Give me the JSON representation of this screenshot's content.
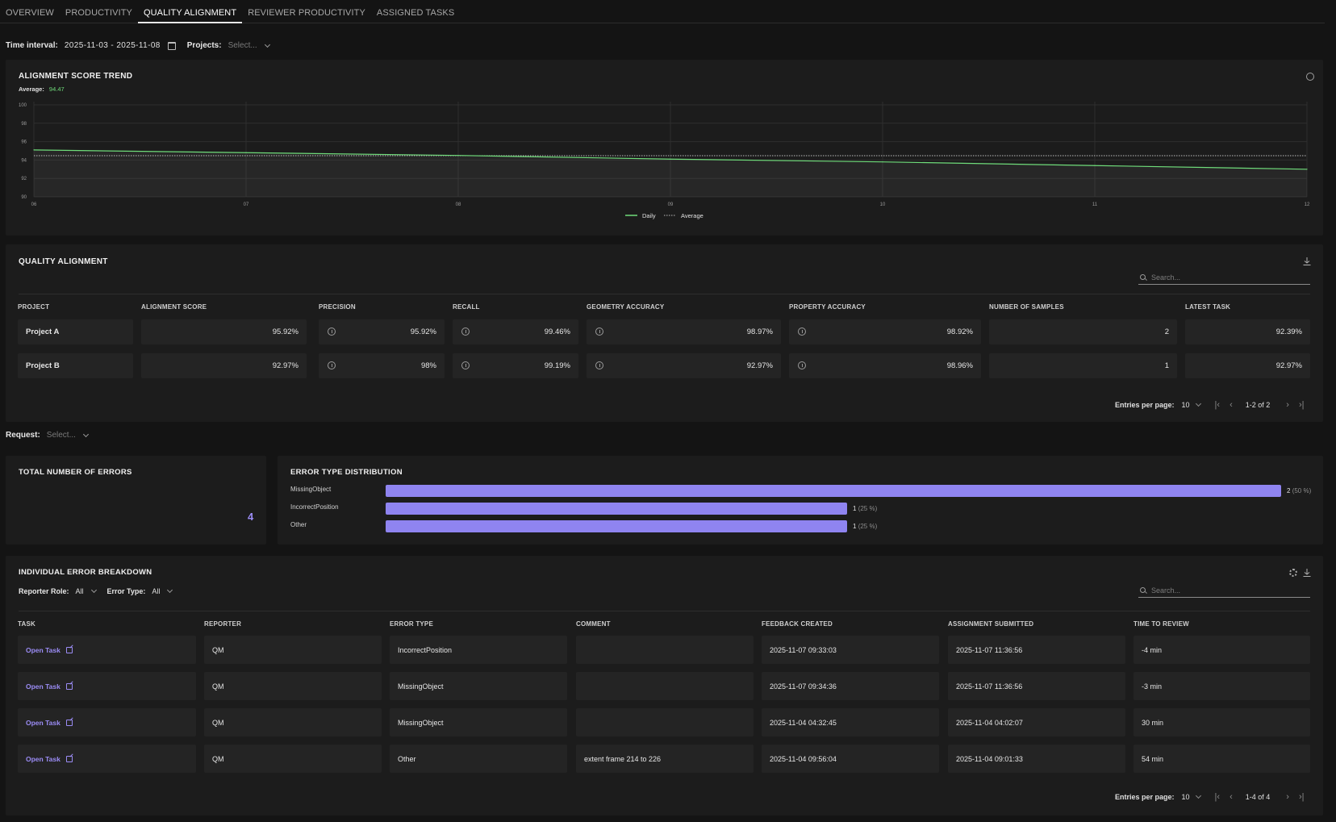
{
  "tabs": [
    "OVERVIEW",
    "PRODUCTIVITY",
    "QUALITY ALIGNMENT",
    "REVIEWER PRODUCTIVITY",
    "ASSIGNED TASKS"
  ],
  "active_tab": "QUALITY ALIGNMENT",
  "filters": {
    "time_label": "Time interval:",
    "time_value": "2025-11-03 - 2025-11-08",
    "projects_label": "Projects:",
    "projects_placeholder": "Select...",
    "request_label": "Request:",
    "request_placeholder": "Select..."
  },
  "trend": {
    "title": "ALIGNMENT SCORE TREND",
    "average_label": "Average:",
    "average_value": "94.47",
    "legend_daily": "Daily",
    "legend_average": "Average"
  },
  "chart_data": {
    "type": "line",
    "title": "ALIGNMENT SCORE TREND",
    "x": [
      "06",
      "07",
      "08",
      "09",
      "10",
      "11",
      "12"
    ],
    "y_ticks": [
      "100",
      "98",
      "96",
      "94",
      "92",
      "90"
    ],
    "ylim": [
      90,
      100
    ],
    "series": [
      {
        "name": "Daily",
        "values": [
          95.1,
          94.8,
          94.5,
          94.1,
          93.8,
          93.4,
          93.0
        ],
        "color": "#6fdc7a"
      },
      {
        "name": "Average",
        "values": [
          94.47,
          94.47,
          94.47,
          94.47,
          94.47,
          94.47,
          94.47
        ],
        "color": "#bbbbbb"
      }
    ],
    "grid": true,
    "legend": "bottom-center"
  },
  "quality": {
    "title": "QUALITY ALIGNMENT",
    "search_placeholder": "Search...",
    "headers": [
      "PROJECT",
      "ALIGNMENT SCORE",
      "PRECISION",
      "RECALL",
      "GEOMETRY ACCURACY",
      "PROPERTY ACCURACY",
      "NUMBER OF SAMPLES",
      "LATEST TASK"
    ],
    "rows": [
      [
        "Project A",
        "95.92%",
        "95.92%",
        "99.46%",
        "98.97%",
        "98.92%",
        "2",
        "92.39%"
      ],
      [
        "Project B",
        "92.97%",
        "98%",
        "99.19%",
        "92.97%",
        "98.96%",
        "1",
        "92.97%"
      ]
    ],
    "pager": {
      "label": "Entries per page:",
      "per_page": "10",
      "range": "1-2 of 2"
    }
  },
  "errors_total": {
    "title": "TOTAL NUMBER OF ERRORS",
    "value": "4"
  },
  "error_dist": {
    "title": "ERROR TYPE DISTRIBUTION",
    "items": [
      {
        "label": "MissingObject",
        "count": "2",
        "pct": "(50 %)",
        "fraction": 1.0
      },
      {
        "label": "IncorrectPosition",
        "count": "1",
        "pct": "(25 %)",
        "fraction": 0.5157
      },
      {
        "label": "Other",
        "count": "1",
        "pct": "(25 %)",
        "fraction": 0.5157
      }
    ]
  },
  "breakdown": {
    "title": "INDIVIDUAL ERROR BREAKDOWN",
    "reporter_role_label": "Reporter Role:",
    "reporter_role_value": "All",
    "error_type_label": "Error Type:",
    "error_type_value": "All",
    "search_placeholder": "Search...",
    "headers": [
      "TASK",
      "REPORTER",
      "ERROR TYPE",
      "COMMENT",
      "FEEDBACK CREATED",
      "ASSIGNMENT SUBMITTED",
      "TIME TO REVIEW"
    ],
    "link_label": "Open Task",
    "rows": [
      [
        "QM",
        "IncorrectPosition",
        "",
        "2025-11-07 09:33:03",
        "2025-11-07 11:36:56",
        "-4 min"
      ],
      [
        "QM",
        "MissingObject",
        "",
        "2025-11-07 09:34:36",
        "2025-11-07 11:36:56",
        "-3 min"
      ],
      [
        "QM",
        "MissingObject",
        "",
        "2025-11-04 04:32:45",
        "2025-11-04 04:02:07",
        "30 min"
      ],
      [
        "QM",
        "Other",
        "extent frame 214 to 226",
        "2025-11-04 09:56:04",
        "2025-11-04 09:01:33",
        "54 min"
      ]
    ],
    "pager": {
      "label": "Entries per page:",
      "per_page": "10",
      "range": "1-4 of 4"
    }
  }
}
